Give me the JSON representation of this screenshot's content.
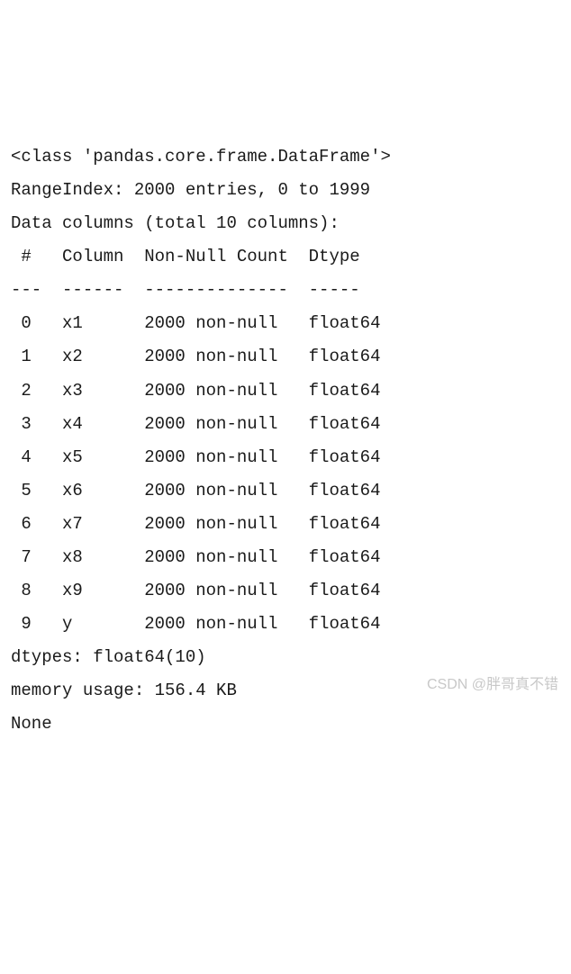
{
  "header": {
    "class_line": "<class 'pandas.core.frame.DataFrame'>",
    "range_index": "RangeIndex: 2000 entries, 0 to 1999",
    "data_columns": "Data columns (total 10 columns):",
    "col_header": " #   Column  Non-Null Count  Dtype  ",
    "divider": "---  ------  --------------  -----  "
  },
  "rows": [
    " 0   x1      2000 non-null   float64",
    " 1   x2      2000 non-null   float64",
    " 2   x3      2000 non-null   float64",
    " 3   x4      2000 non-null   float64",
    " 4   x5      2000 non-null   float64",
    " 5   x6      2000 non-null   float64",
    " 6   x7      2000 non-null   float64",
    " 7   x8      2000 non-null   float64",
    " 8   x9      2000 non-null   float64",
    " 9   y       2000 non-null   float64"
  ],
  "footer": {
    "dtypes": "dtypes: float64(10)",
    "memory": "memory usage: 156.4 KB",
    "none": "None"
  },
  "watermark": "CSDN @胖哥真不错"
}
